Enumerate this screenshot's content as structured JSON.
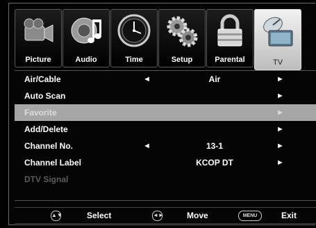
{
  "tabs": [
    {
      "label": "Picture",
      "icon": "camcorder-icon"
    },
    {
      "label": "Audio",
      "icon": "speaker-music-icon"
    },
    {
      "label": "Time",
      "icon": "clock-icon"
    },
    {
      "label": "Setup",
      "icon": "gears-icon"
    },
    {
      "label": "Parental",
      "icon": "padlock-icon"
    },
    {
      "label": "TV",
      "icon": "satellite-tv-icon",
      "active": true
    }
  ],
  "menu": {
    "items": [
      {
        "label": "Air/Cable",
        "value": "Air",
        "left_arrow": "◄",
        "right_arrow": "►"
      },
      {
        "label": "Auto Scan",
        "value": "",
        "left_arrow": "",
        "right_arrow": "►"
      },
      {
        "label": "Favorite",
        "value": "",
        "left_arrow": "",
        "right_arrow": "►",
        "selected": true
      },
      {
        "label": "Add/Delete",
        "value": "",
        "left_arrow": "",
        "right_arrow": "►"
      },
      {
        "label": "Channel No.",
        "value": "13-1",
        "left_arrow": "◄",
        "right_arrow": "►"
      },
      {
        "label": "Channel Label",
        "value": "KCOP DT",
        "left_arrow": "",
        "right_arrow": "►"
      },
      {
        "label": "DTV Signal",
        "value": "",
        "left_arrow": "",
        "right_arrow": "",
        "disabled": true
      }
    ]
  },
  "footer": {
    "select_keys": "▲▼",
    "select_label": "Select",
    "move_keys": "◄►",
    "move_label": "Move",
    "menu_key": "MENU",
    "exit_label": "Exit"
  },
  "colors": {
    "background": "#000000",
    "selected_row": "#a6a6a6",
    "disabled_text": "#5b5b5b",
    "active_tab": "#e6e6e6"
  }
}
